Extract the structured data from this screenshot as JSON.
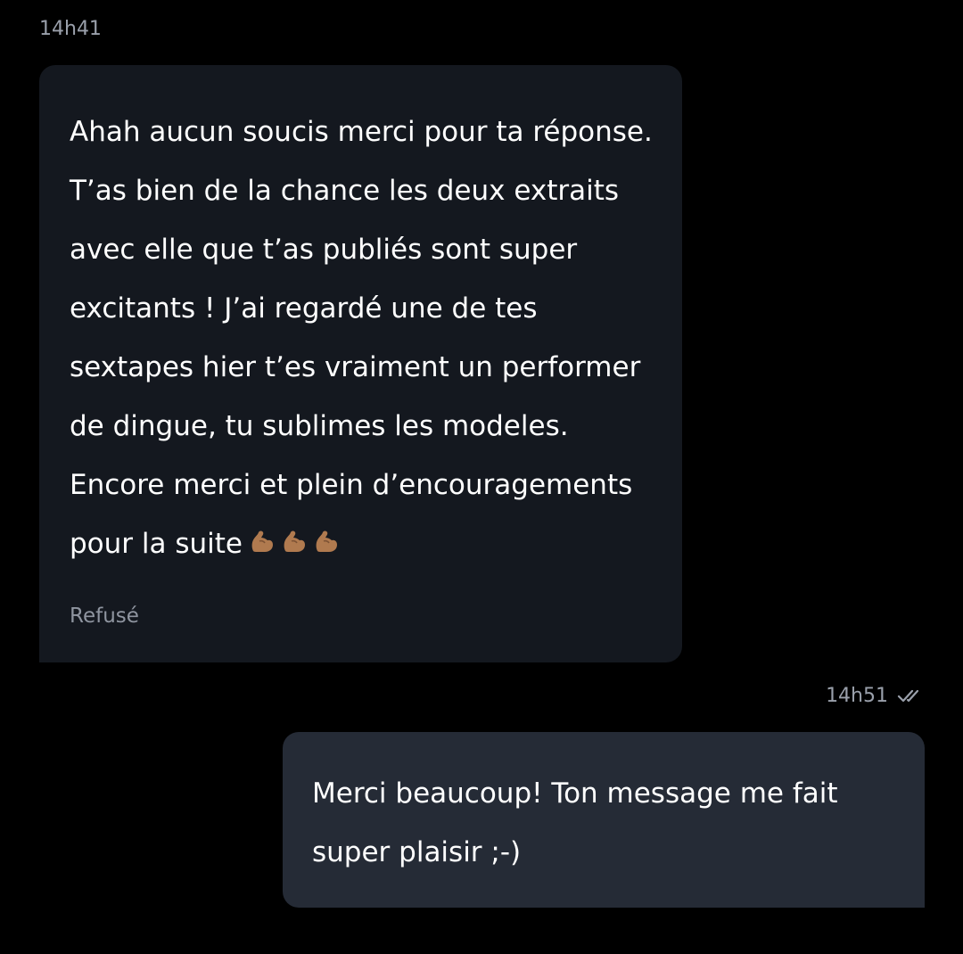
{
  "incoming": {
    "timestamp": "14h41",
    "message": "Ahah aucun soucis merci pour ta réponse. T’as bien de la chance les deux extraits avec elle que t’as publiés sont super excitants ! J’ai regardé une de tes sextapes hier t’es vraiment un performer de dingue, tu sublimes les modeles. Encore merci et plein d’encouragements pour la suite",
    "emojis": [
      "flexed-biceps",
      "flexed-biceps",
      "flexed-biceps"
    ],
    "status": "Refusé"
  },
  "outgoing": {
    "timestamp": "14h51",
    "read_icon": "double-check-icon",
    "message": "Merci beaucoup! Ton message me fait super plaisir ;-)"
  },
  "colors": {
    "background": "#000000",
    "incoming_bubble": "#14181f",
    "outgoing_bubble": "#252b36",
    "timestamp": "#9aa0ab",
    "emoji_skin": "#b07a4f"
  }
}
